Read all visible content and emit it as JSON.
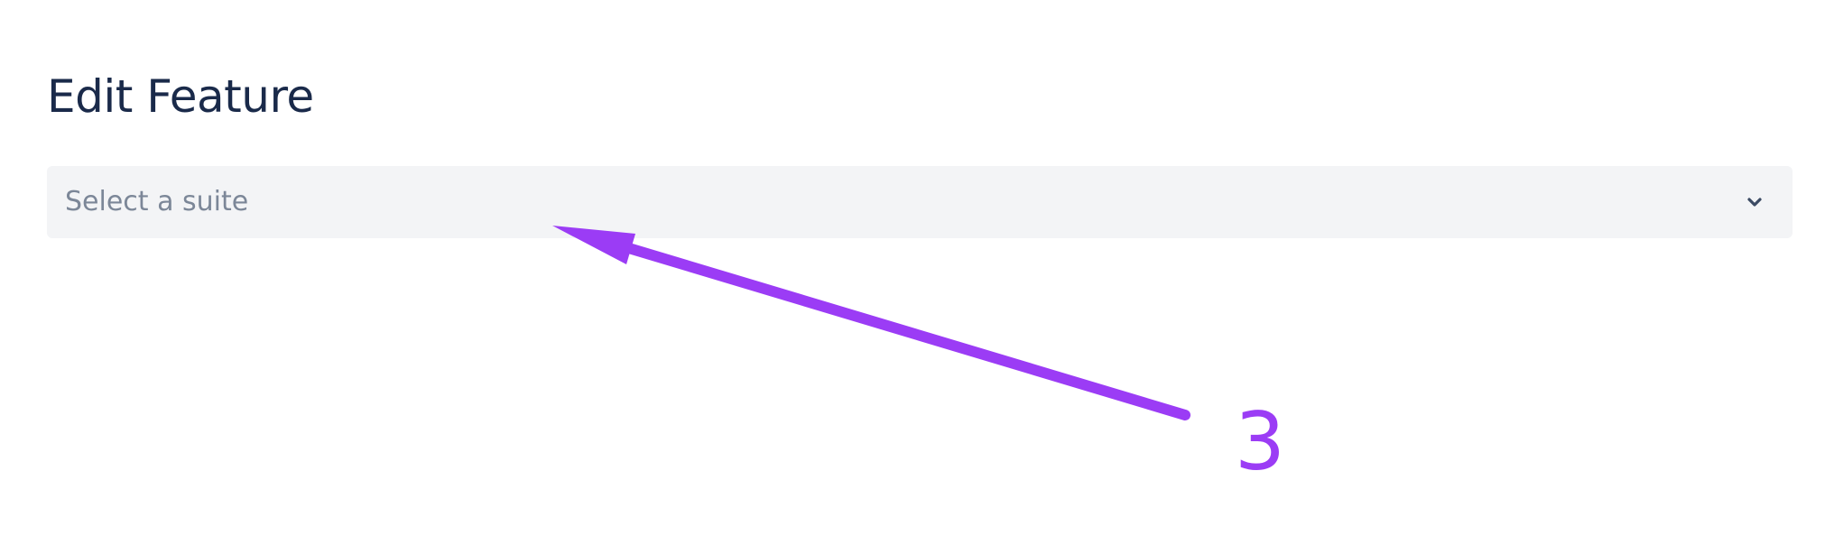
{
  "page": {
    "title": "Edit Feature"
  },
  "suite_select": {
    "placeholder": "Select a suite",
    "icon": "chevron-down-icon"
  },
  "annotation": {
    "step_label": "3",
    "color": "#9b3cf5"
  },
  "colors": {
    "title_text": "#1a2a4a",
    "select_background": "#f3f4f6",
    "placeholder_text": "#7c8798",
    "chevron": "#3b4a63"
  }
}
